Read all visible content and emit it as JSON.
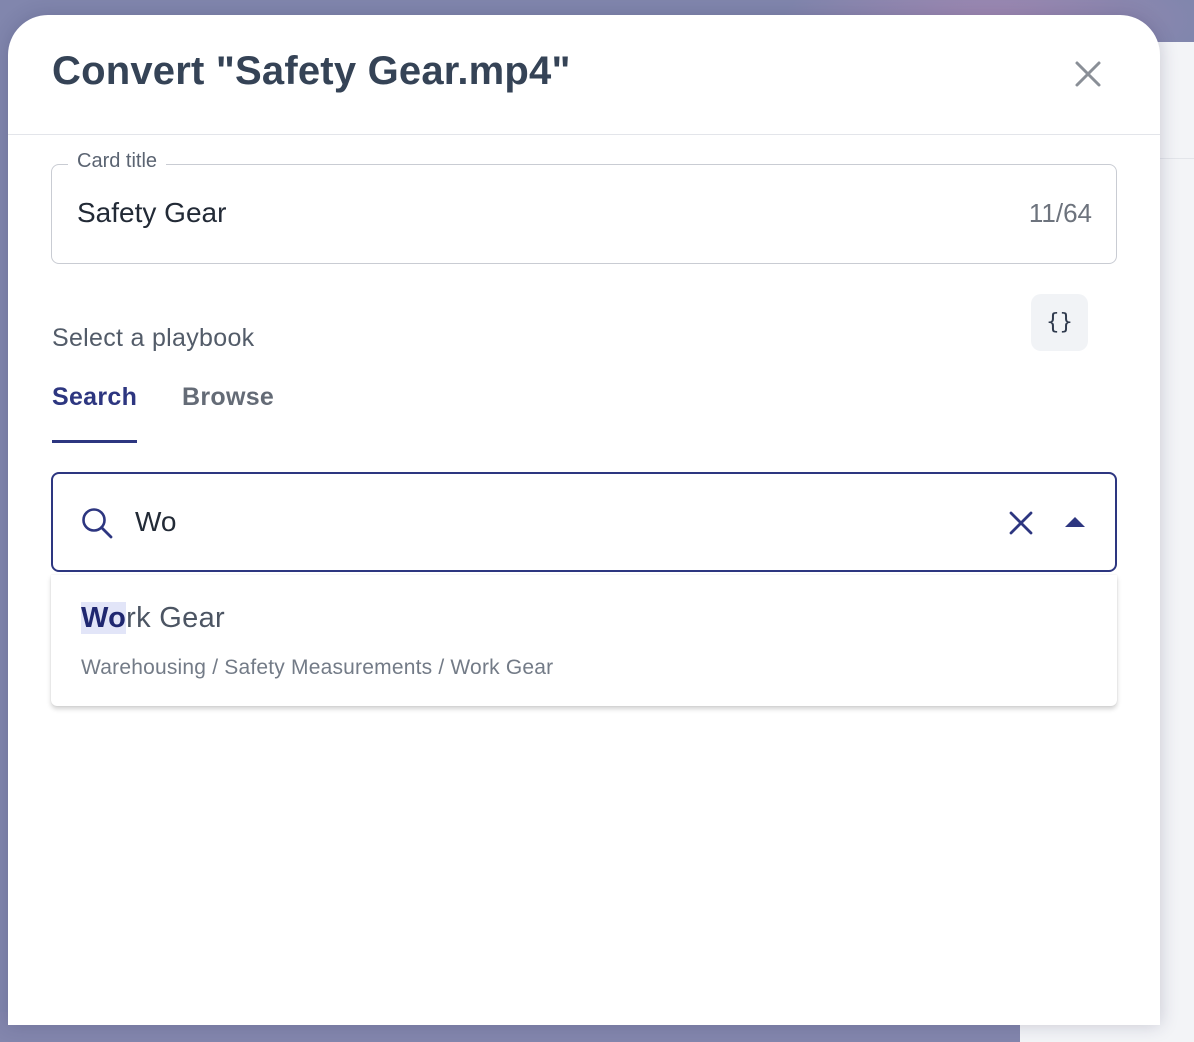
{
  "dialog": {
    "title": "Convert \"Safety Gear.mp4\""
  },
  "card_title": {
    "label": "Card title",
    "value": "Safety Gear",
    "counter": "11/64"
  },
  "playbook": {
    "label": "Select a playbook",
    "variables_button": "{}",
    "tabs": [
      {
        "label": "Search",
        "active": true
      },
      {
        "label": "Browse",
        "active": false
      }
    ]
  },
  "search": {
    "value": "Wo"
  },
  "results": [
    {
      "title_match": "Wo",
      "title_rest": "rk Gear",
      "path": "Warehousing / Safety Measurements / Work Gear"
    }
  ],
  "colors": {
    "accent": "#2d3680",
    "highlight_bg": "#e2e5f8",
    "backdrop": "#8186ad"
  },
  "icons": {
    "close": "close-icon",
    "search": "search-icon",
    "clear": "clear-icon",
    "caret": "caret-up-icon"
  }
}
